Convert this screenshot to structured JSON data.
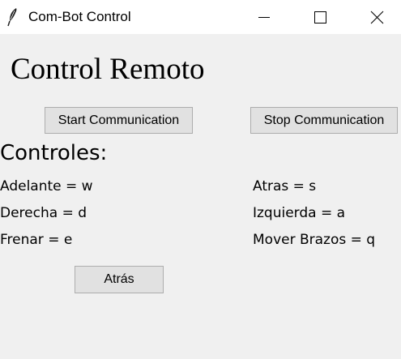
{
  "window": {
    "title": "Com-Bot Control"
  },
  "icons": {
    "app": "feather-icon",
    "minimize": "minimize-icon",
    "maximize": "maximize-icon",
    "close": "close-icon"
  },
  "main": {
    "heading": "Control Remoto",
    "start_button": "Start Communication",
    "stop_button": "Stop Communication",
    "controls_heading": "Controles:",
    "controls": [
      {
        "label": "Adelante = w"
      },
      {
        "label": "Atras = s"
      },
      {
        "label": "Derecha = d"
      },
      {
        "label": "Izquierda = a"
      },
      {
        "label": "Frenar = e"
      },
      {
        "label": "Mover Brazos = q"
      }
    ],
    "back_button": "Atrás"
  }
}
